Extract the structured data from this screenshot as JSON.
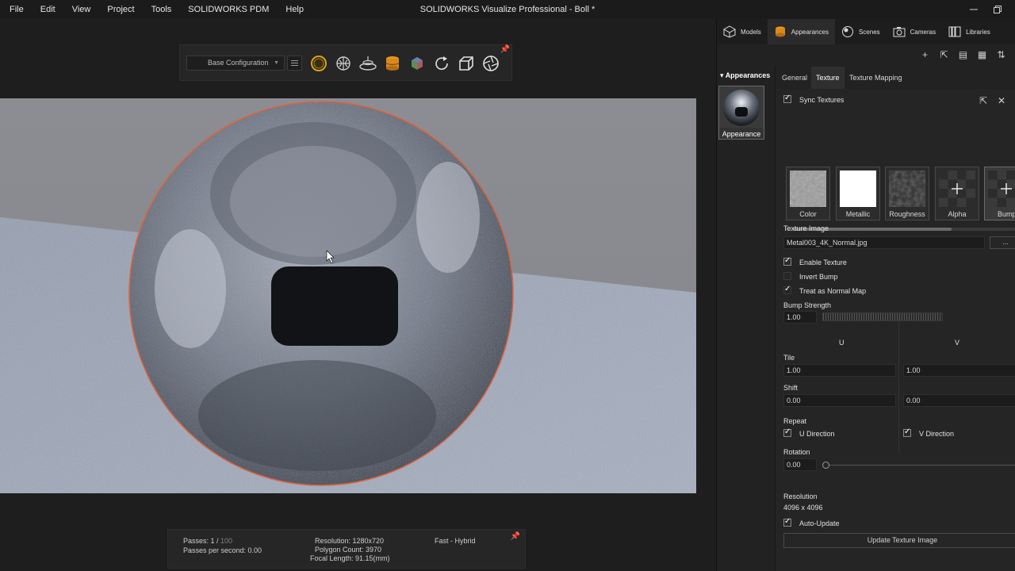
{
  "menu": [
    "File",
    "Edit",
    "View",
    "Project",
    "Tools",
    "SOLIDWORKS PDM",
    "Help"
  ],
  "window": {
    "title": "SOLIDWORKS Visualize Professional - Boll *"
  },
  "toolbar": {
    "configuration": "Base Configuration",
    "icons": [
      "appearance-ring-icon",
      "camera-orbit-icon",
      "floor-icon",
      "cylinder-tool-icon",
      "cube-tool-icon",
      "refresh-icon",
      "render-output-icon",
      "shutter-icon"
    ]
  },
  "status": {
    "passes_label": "Passes: 1 /",
    "passes_max": "100",
    "passes_per_second": "Passes per second: 0.00",
    "resolution": "Resolution: 1280x720",
    "polygon_count": "Polygon Count: 3970",
    "focal_length": "Focal Length: 91.15(mm)",
    "render_mode": "Fast - Hybrid"
  },
  "panel": {
    "tabs": [
      "Models",
      "Appearances",
      "Scenes",
      "Cameras",
      "Libraries"
    ],
    "active_tab": "Appearances",
    "appearances_header": "Appearances",
    "appearance_item": "Appearance",
    "subtabs": [
      "General",
      "Texture",
      "Texture Mapping"
    ],
    "sync_textures": "Sync Textures",
    "textures": [
      "Color",
      "Metallic",
      "Roughness",
      "Alpha",
      "Bump"
    ],
    "texture_image_label": "Texture Image",
    "texture_image_value": "Metal003_4K_Normal.jpg",
    "browse": "...",
    "enable_texture": "Enable Texture",
    "invert_bump": "Invert Bump",
    "treat_normal_map": "Treat as Normal Map",
    "bump_strength_label": "Bump Strength",
    "bump_strength_value": "1.00",
    "u_header": "U",
    "v_header": "V",
    "tile_label": "Tile",
    "tile_u": "1.00",
    "tile_v": "1.00",
    "shift_label": "Shift",
    "shift_u": "0.00",
    "shift_v": "0.00",
    "repeat_label": "Repeat",
    "u_direction": "U Direction",
    "v_direction": "V Direction",
    "rotation_label": "Rotation",
    "rotation_value": "0.00",
    "resolution_label": "Resolution",
    "resolution_value": "4096 x 4096",
    "auto_update": "Auto-Update",
    "update_button": "Update Texture Image"
  },
  "colors": {
    "selection_outline": "#e0623c",
    "accent_orange": "#d9881c"
  }
}
